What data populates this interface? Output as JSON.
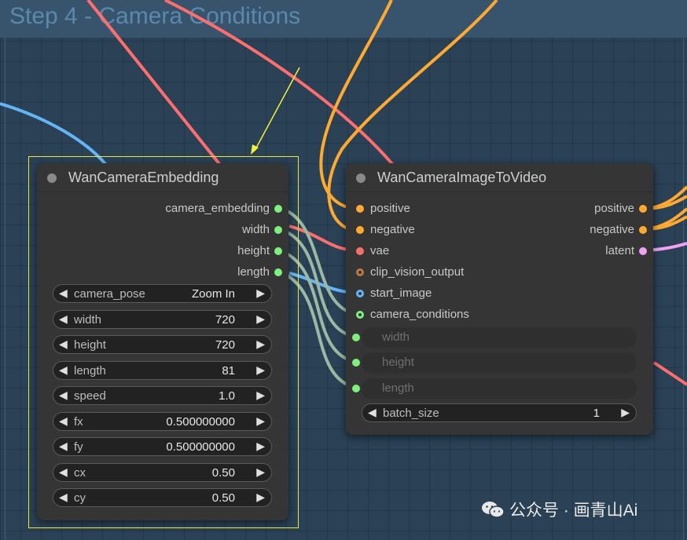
{
  "group": {
    "title": "Step 4 - Camera Conditions"
  },
  "nodes": {
    "embedding": {
      "title": "WanCameraEmbedding",
      "outputs": [
        {
          "label": "camera_embedding",
          "type_color": "#7df07d"
        },
        {
          "label": "width",
          "type_color": "#7df07d"
        },
        {
          "label": "height",
          "type_color": "#7df07d"
        },
        {
          "label": "length",
          "type_color": "#7df07d"
        }
      ],
      "widgets": [
        {
          "name": "camera_pose",
          "value": "Zoom In"
        },
        {
          "name": "width",
          "value": "720"
        },
        {
          "name": "height",
          "value": "720"
        },
        {
          "name": "length",
          "value": "81"
        },
        {
          "name": "speed",
          "value": "1.0"
        },
        {
          "name": "fx",
          "value": "0.500000000"
        },
        {
          "name": "fy",
          "value": "0.500000000"
        },
        {
          "name": "cx",
          "value": "0.50"
        },
        {
          "name": "cy",
          "value": "0.50"
        }
      ]
    },
    "i2v": {
      "title": "WanCameraImageToVideo",
      "inputs": [
        {
          "label": "positive",
          "type_color": "#ffa931"
        },
        {
          "label": "negative",
          "type_color": "#ffa931"
        },
        {
          "label": "vae",
          "type_color": "#ff6e6e"
        },
        {
          "label": "clip_vision_output",
          "type_color": "#b87a48"
        },
        {
          "label": "start_image",
          "type_color": "#64b5f6"
        },
        {
          "label": "camera_conditions",
          "type_color": "#7df07d"
        }
      ],
      "outputs": [
        {
          "label": "positive",
          "type_color": "#ffa931"
        },
        {
          "label": "negative",
          "type_color": "#ffa931"
        },
        {
          "label": "latent",
          "type_color": "#f2a0f2"
        }
      ],
      "converted_widgets": [
        {
          "name": "width"
        },
        {
          "name": "height"
        },
        {
          "name": "length"
        }
      ],
      "widgets": [
        {
          "name": "batch_size",
          "value": "1"
        }
      ]
    }
  },
  "watermark": {
    "text": "公众号 · 画青山Ai",
    "icon": "wechat-icon"
  },
  "icons": {
    "left_arrow": "◀",
    "right_arrow": "▶"
  },
  "colors": {
    "canvas": "#2a4156",
    "group_header": "#38546c",
    "node_bg": "#353535",
    "highlight": "#e8e83a"
  }
}
